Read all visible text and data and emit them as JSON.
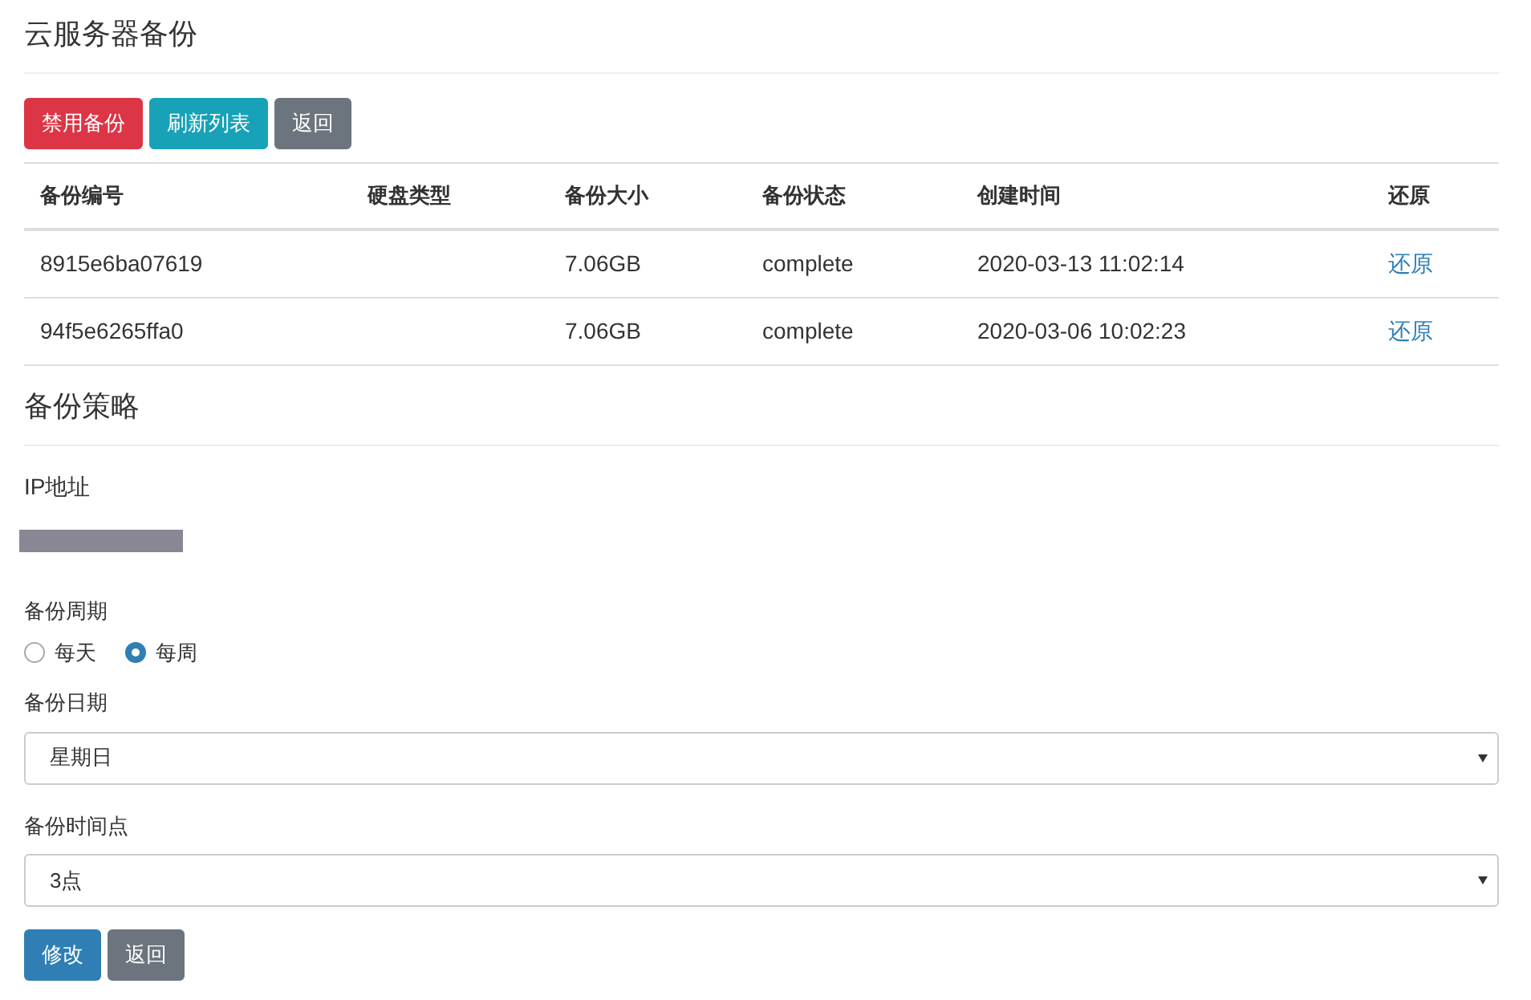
{
  "title": "云服务器备份",
  "toolbar": [
    {
      "label": "禁用备份",
      "kind": "danger"
    },
    {
      "label": "刷新列表",
      "kind": "info"
    },
    {
      "label": "返回",
      "kind": "secondary"
    }
  ],
  "table": {
    "columns": [
      "备份编号",
      "硬盘类型",
      "备份大小",
      "备份状态",
      "创建时间",
      "还原"
    ],
    "rows": [
      {
        "cells": [
          "8915e6ba07619",
          "",
          "7.06GB",
          "complete",
          "2020-03-13 11:02:14"
        ],
        "action": "还原"
      },
      {
        "cells": [
          "94f5e6265ffa0",
          "",
          "7.06GB",
          "complete",
          "2020-03-06 10:02:23"
        ],
        "action": "还原"
      }
    ]
  },
  "policy": {
    "title": "备份策略",
    "ip_label": "IP地址",
    "period_label": "备份周期",
    "period_options": [
      {
        "label": "每天",
        "selected": false
      },
      {
        "label": "每周",
        "selected": true
      }
    ],
    "date_label": "备份日期",
    "date_value": "星期日",
    "time_label": "备份时间点",
    "time_value": "3点",
    "buttons": [
      {
        "label": "修改",
        "kind": "primary"
      },
      {
        "label": "返回",
        "kind": "secondary"
      }
    ]
  }
}
